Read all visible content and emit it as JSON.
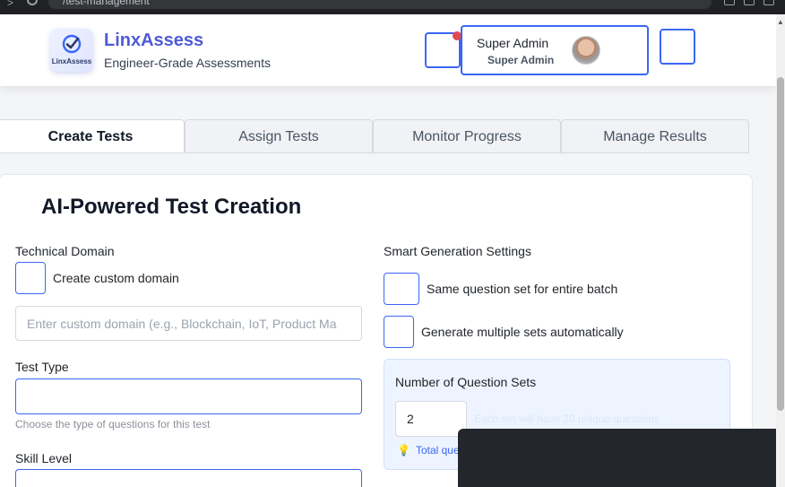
{
  "browser": {
    "url_text": "/test-management"
  },
  "header": {
    "logo_text": "LinxAssess",
    "brand": "LinxAssess",
    "tagline": "Engineer-Grade Assessments",
    "user": {
      "name": "Super Admin",
      "role": "Super Admin"
    },
    "notification_dot_color": "#e5484d",
    "accent_color": "#3b66f5"
  },
  "tabs": [
    {
      "label": "Create Tests",
      "active": true
    },
    {
      "label": "Assign Tests",
      "active": false
    },
    {
      "label": "Monitor Progress",
      "active": false
    },
    {
      "label": "Manage Results",
      "active": false
    }
  ],
  "creation": {
    "title": "AI-Powered Test Creation",
    "technical_domain_label": "Technical Domain",
    "custom_domain_checkbox_label": "Create custom domain",
    "custom_domain_placeholder": "Enter custom domain (e.g., Blockchain, IoT, Product Ma",
    "test_type_label": "Test Type",
    "test_type_hint": "Choose the type of questions for this test",
    "skill_level_label": "Skill Level"
  },
  "smart_settings": {
    "label": "Smart Generation Settings",
    "same_set_label": "Same question set for entire batch",
    "multiple_sets_label": "Generate multiple sets automatically",
    "number_of_sets_label": "Number of Question Sets",
    "number_of_sets_value": "2",
    "sets_note": "Each set will have 20 unique questions",
    "total_text": "Total que"
  }
}
